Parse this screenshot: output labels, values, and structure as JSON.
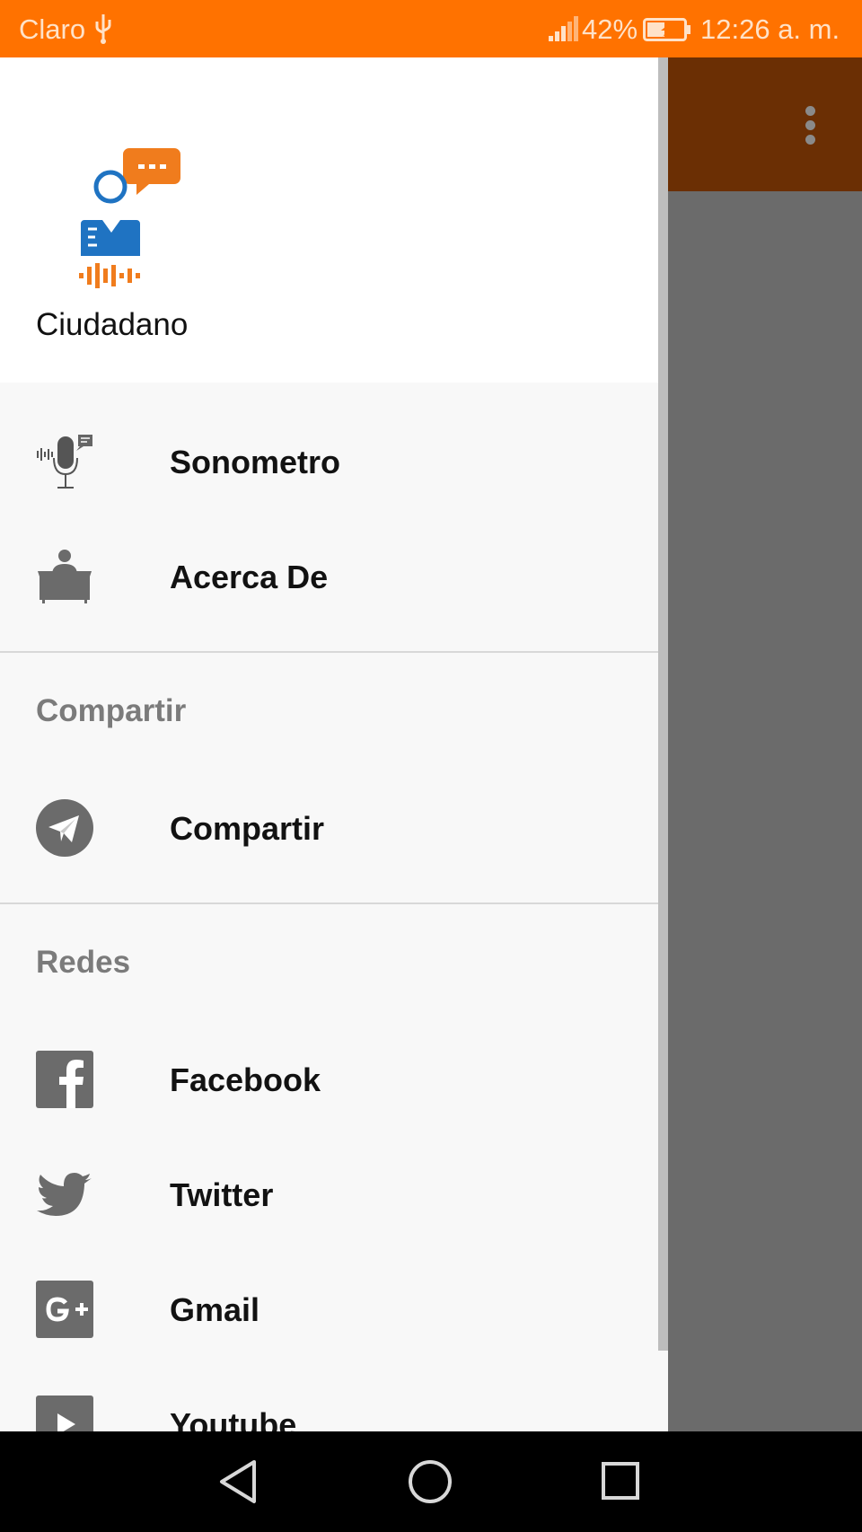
{
  "status_bar": {
    "carrier": "Claro",
    "battery_percent": "42%",
    "time": "12:26 a. m."
  },
  "drawer": {
    "header_title": "Ciudadano",
    "items": [
      {
        "label": "Sonometro",
        "icon": "microphone-icon"
      },
      {
        "label": "Acerca De",
        "icon": "desk-person-icon"
      }
    ],
    "sections": [
      {
        "title": "Compartir",
        "items": [
          {
            "label": "Compartir",
            "icon": "send-icon"
          }
        ]
      },
      {
        "title": "Redes",
        "items": [
          {
            "label": "Facebook",
            "icon": "facebook-icon"
          },
          {
            "label": "Twitter",
            "icon": "twitter-icon"
          },
          {
            "label": "Gmail",
            "icon": "google-plus-icon"
          },
          {
            "label": "Youtube",
            "icon": "youtube-icon"
          }
        ]
      }
    ]
  },
  "colors": {
    "status_bar": "#ff7200",
    "app_bar_dimmed": "#6b2f04",
    "icon_gray": "#6b6b6b",
    "logo_blue": "#1f73c2",
    "logo_orange": "#f07c1d"
  }
}
